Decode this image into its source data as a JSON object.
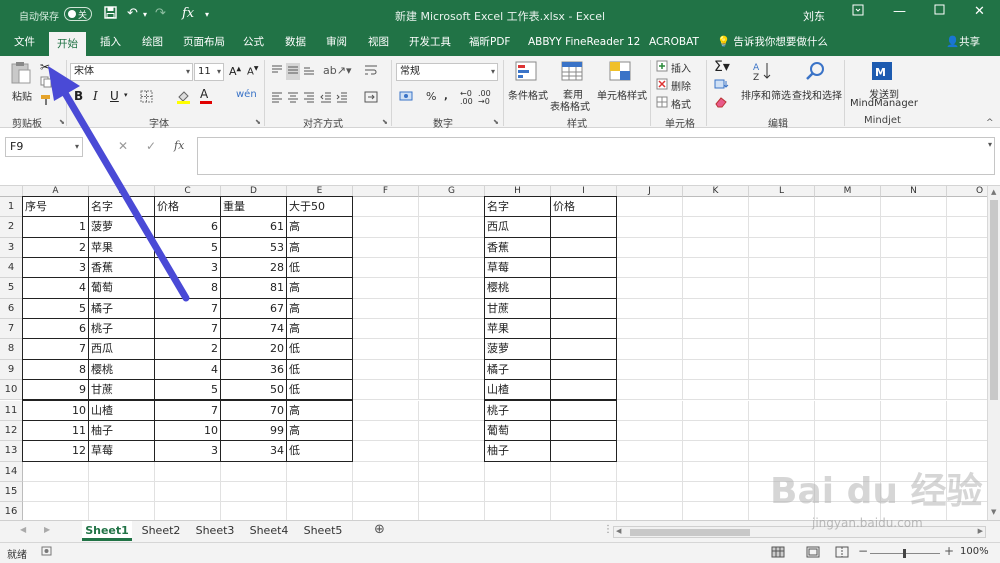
{
  "titlebar": {
    "autosave_label": "自动保存",
    "autosave_state": "关",
    "document_title": "新建 Microsoft Excel 工作表.xlsx  -  Excel",
    "user": "刘东"
  },
  "tabs": [
    "文件",
    "开始",
    "插入",
    "绘图",
    "页面布局",
    "公式",
    "数据",
    "审阅",
    "视图",
    "开发工具",
    "福昕PDF",
    "ABBYY FineReader 12",
    "ACROBAT"
  ],
  "active_tab": "开始",
  "tell_me": "告诉我你想要做什么",
  "share": "共享",
  "ribbon": {
    "paste": "粘贴",
    "clipboard_group": "剪贴板",
    "font_name": "宋体",
    "font_size": "11",
    "font_group": "字体",
    "align_group": "对齐方式",
    "number_format": "常规",
    "number_group": "数字",
    "conditional_format": "条件格式",
    "table_format_1": "套用",
    "table_format_2": "表格格式",
    "cell_styles": "单元格样式",
    "styles_group": "样式",
    "insert": "插入",
    "delete": "删除",
    "format": "格式",
    "cells_group": "单元格",
    "sort_filter": "排序和筛选",
    "find_select": "查找和选择",
    "editing_group": "编辑",
    "send_to_1": "发送到",
    "send_to_2": "MindManager",
    "mindjet_group": "Mindjet"
  },
  "formula_bar": {
    "name_box": "F9",
    "formula": ""
  },
  "columns": [
    "A",
    "B",
    "C",
    "D",
    "E",
    "F",
    "G",
    "H",
    "I",
    "J",
    "K",
    "L",
    "M",
    "N",
    "O"
  ],
  "rows": [
    "1",
    "2",
    "3",
    "4",
    "5",
    "6",
    "7",
    "8",
    "9",
    "10",
    "11",
    "12",
    "13",
    "14",
    "15",
    "16"
  ],
  "table1": {
    "headers": [
      "序号",
      "名字",
      "价格",
      "重量",
      "大于50"
    ],
    "rows": [
      [
        "1",
        "菠萝",
        "6",
        "61",
        "高"
      ],
      [
        "2",
        "苹果",
        "5",
        "53",
        "高"
      ],
      [
        "3",
        "香蕉",
        "3",
        "28",
        "低"
      ],
      [
        "4",
        "葡萄",
        "8",
        "81",
        "高"
      ],
      [
        "5",
        "橘子",
        "7",
        "67",
        "高"
      ],
      [
        "6",
        "桃子",
        "7",
        "74",
        "高"
      ],
      [
        "7",
        "西瓜",
        "2",
        "20",
        "低"
      ],
      [
        "8",
        "樱桃",
        "4",
        "36",
        "低"
      ],
      [
        "9",
        "甘蔗",
        "5",
        "50",
        "低"
      ],
      [
        "10",
        "山楂",
        "7",
        "70",
        "高"
      ],
      [
        "11",
        "柚子",
        "10",
        "99",
        "高"
      ],
      [
        "12",
        "草莓",
        "3",
        "34",
        "低"
      ]
    ]
  },
  "table2": {
    "headers": [
      "名字",
      "价格"
    ],
    "rows": [
      [
        "西瓜",
        ""
      ],
      [
        "香蕉",
        ""
      ],
      [
        "草莓",
        ""
      ],
      [
        "樱桃",
        ""
      ],
      [
        "甘蔗",
        ""
      ],
      [
        "苹果",
        ""
      ],
      [
        "菠萝",
        ""
      ],
      [
        "橘子",
        ""
      ],
      [
        "山楂",
        ""
      ],
      [
        "桃子",
        ""
      ],
      [
        "葡萄",
        ""
      ],
      [
        "柚子",
        ""
      ]
    ]
  },
  "sheets": [
    "Sheet1",
    "Sheet2",
    "Sheet3",
    "Sheet4",
    "Sheet5"
  ],
  "active_sheet": "Sheet1",
  "status": {
    "ready": "就绪",
    "zoom": "100%"
  },
  "watermark": {
    "logo": "Bai du 经验",
    "url": "jingyan.baidu.com"
  },
  "colors": {
    "brand": "#217346",
    "annotation_arrow": "#4a4ad6"
  }
}
